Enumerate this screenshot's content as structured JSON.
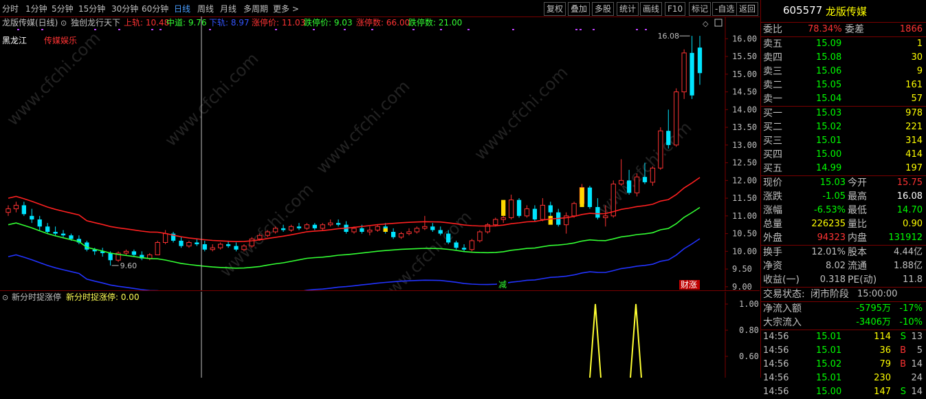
{
  "toolbar": {
    "periods": [
      "分时",
      "1分钟",
      "5分钟",
      "15分钟",
      "30分钟",
      "60分钟",
      "日线",
      "周线",
      "月线",
      "多周期",
      "更多 >"
    ],
    "active_period": "日线",
    "buttons": [
      "复权",
      "叠加",
      "多股",
      "统计",
      "画线",
      "F10",
      "标记",
      "-自选",
      "返回"
    ]
  },
  "main": {
    "title": "龙版传媒(日线)",
    "indicator_name": "独创龙行天下",
    "params": [
      {
        "label": "上轨: 10.48",
        "color": "#ff3333"
      },
      {
        "label": "中道: 9.76",
        "color": "#33ff33"
      },
      {
        "label": "下轨: 8.97",
        "color": "#3355ff"
      },
      {
        "label": "涨停价: 11.03",
        "color": "#ff3333"
      },
      {
        "label": "跌停价: 9.03",
        "color": "#33ff33"
      },
      {
        "label": "涨停数: 66.00",
        "color": "#ff3333"
      },
      {
        "label": "跌停数: 21.00",
        "color": "#33ff33"
      }
    ],
    "tag1": "黑龙江",
    "tag2": "传媒娱乐",
    "y_axis": [
      "16.00",
      "15.50",
      "15.00",
      "14.50",
      "14.00",
      "13.50",
      "13.00",
      "12.50",
      "12.00",
      "11.50",
      "11.00",
      "10.50",
      "10.00",
      "9.50",
      "9.00"
    ],
    "high_label": "16.08",
    "low_label": "9.60",
    "marker_reduce": "减",
    "marker_limit": "财涨"
  },
  "sub": {
    "title": "新分时捉涨停",
    "value_label": "新分时捉涨停: 0.00",
    "y_axis": [
      "1.00",
      "0.80",
      "0.60"
    ]
  },
  "watermark": "www.cfchi.com",
  "quote": {
    "code": "605577",
    "name": "龙版传媒",
    "weibi_label": "委比",
    "weibi": "78.34%",
    "weicha_label": "委差",
    "weicha": "1866",
    "asks": [
      {
        "label": "卖五",
        "price": "15.09",
        "vol": "1"
      },
      {
        "label": "卖四",
        "price": "15.08",
        "vol": "30"
      },
      {
        "label": "卖三",
        "price": "15.06",
        "vol": "9"
      },
      {
        "label": "卖二",
        "price": "15.05",
        "vol": "161"
      },
      {
        "label": "卖一",
        "price": "15.04",
        "vol": "57"
      }
    ],
    "bids": [
      {
        "label": "买一",
        "price": "15.03",
        "vol": "978"
      },
      {
        "label": "买二",
        "price": "15.02",
        "vol": "221"
      },
      {
        "label": "买三",
        "price": "15.01",
        "vol": "314"
      },
      {
        "label": "买四",
        "price": "15.00",
        "vol": "414"
      },
      {
        "label": "买五",
        "price": "14.99",
        "vol": "197"
      }
    ],
    "stats": [
      {
        "l1": "现价",
        "v1": "15.03",
        "c1": "#00ff00",
        "l2": "今开",
        "v2": "15.75",
        "c2": "#ff3333"
      },
      {
        "l1": "涨跌",
        "v1": "-1.05",
        "c1": "#00ff00",
        "l2": "最高",
        "v2": "16.08",
        "c2": "#ffffff"
      },
      {
        "l1": "涨幅",
        "v1": "-6.53%",
        "c1": "#00ff00",
        "l2": "最低",
        "v2": "14.70",
        "c2": "#00ff00"
      },
      {
        "l1": "总量",
        "v1": "226235",
        "c1": "#ffff00",
        "l2": "量比",
        "v2": "0.90",
        "c2": "#ffff00"
      },
      {
        "l1": "外盘",
        "v1": "94323",
        "c1": "#ff3333",
        "l2": "内盘",
        "v2": "131912",
        "c2": "#00ff00"
      }
    ],
    "stats2": [
      {
        "l1": "换手",
        "v1": "12.01%",
        "l2": "股本",
        "v2": "4.44亿"
      },
      {
        "l1": "净资",
        "v1": "8.02",
        "l2": "流通",
        "v2": "1.88亿"
      },
      {
        "l1": "收益(一)",
        "v1": "0.318",
        "l2": "PE(动)",
        "v2": "11.8"
      }
    ],
    "status_label": "交易状态:",
    "status": "闭市阶段",
    "status_time": "15:00:00",
    "flow": [
      {
        "label": "净流入额",
        "val": "-5795万",
        "pct": "-17%"
      },
      {
        "label": "大宗流入",
        "val": "-3406万",
        "pct": "-10%"
      }
    ],
    "ticks": [
      {
        "time": "14:56",
        "price": "15.01",
        "vol": "114",
        "side": "S",
        "n": "13"
      },
      {
        "time": "14:56",
        "price": "15.01",
        "vol": "36",
        "side": "B",
        "n": "5"
      },
      {
        "time": "14:56",
        "price": "15.02",
        "vol": "79",
        "side": "B",
        "n": "14"
      },
      {
        "time": "14:56",
        "price": "15.01",
        "vol": "230",
        "side": "",
        "n": "24"
      },
      {
        "time": "14:56",
        "price": "15.00",
        "vol": "147",
        "side": "S",
        "n": "14"
      }
    ]
  },
  "chart_data": {
    "type": "candlestick",
    "title": "龙版传媒(日线)",
    "ylim": [
      8.9,
      16.2
    ],
    "candles": [
      [
        11.1,
        11.3,
        11.0,
        11.2
      ],
      [
        11.2,
        11.4,
        11.1,
        11.3
      ],
      [
        11.3,
        11.4,
        11.0,
        11.05
      ],
      [
        11.0,
        11.2,
        10.8,
        10.9
      ],
      [
        10.9,
        11.0,
        10.6,
        10.7
      ],
      [
        10.7,
        10.8,
        10.5,
        10.55
      ],
      [
        10.55,
        10.7,
        10.45,
        10.5
      ],
      [
        10.5,
        10.6,
        10.4,
        10.45
      ],
      [
        10.45,
        10.5,
        10.3,
        10.35
      ],
      [
        10.35,
        10.45,
        10.2,
        10.25
      ],
      [
        10.25,
        10.3,
        10.0,
        10.05
      ],
      [
        10.05,
        10.1,
        9.9,
        10.0
      ],
      [
        10.0,
        10.1,
        9.85,
        9.95
      ],
      [
        9.95,
        10.0,
        9.6,
        9.75
      ],
      [
        9.75,
        10.0,
        9.7,
        9.95
      ],
      [
        9.95,
        10.05,
        9.9,
        10.0
      ],
      [
        10.0,
        10.05,
        9.85,
        9.9
      ],
      [
        9.9,
        10.0,
        9.75,
        9.8
      ],
      [
        9.8,
        9.95,
        9.75,
        9.9
      ],
      [
        9.9,
        10.3,
        9.9,
        10.25
      ],
      [
        10.25,
        10.6,
        10.2,
        10.5
      ],
      [
        10.5,
        10.55,
        10.25,
        10.3
      ],
      [
        10.3,
        10.4,
        10.1,
        10.15
      ],
      [
        10.15,
        10.3,
        10.1,
        10.25
      ],
      [
        10.25,
        10.35,
        10.15,
        10.2
      ],
      [
        10.2,
        10.3,
        10.0,
        10.05
      ],
      [
        10.05,
        10.2,
        10.0,
        10.1
      ],
      [
        10.1,
        10.25,
        10.05,
        10.2
      ],
      [
        10.2,
        10.3,
        10.1,
        10.15
      ],
      [
        10.15,
        10.25,
        10.0,
        10.05
      ],
      [
        10.05,
        10.2,
        10.0,
        10.15
      ],
      [
        10.15,
        10.4,
        10.1,
        10.35
      ],
      [
        10.35,
        10.5,
        10.3,
        10.45
      ],
      [
        10.45,
        10.6,
        10.4,
        10.55
      ],
      [
        10.55,
        10.7,
        10.5,
        10.65
      ],
      [
        10.65,
        10.75,
        10.55,
        10.6
      ],
      [
        10.6,
        10.75,
        10.55,
        10.7
      ],
      [
        10.7,
        10.8,
        10.6,
        10.65
      ],
      [
        10.65,
        10.8,
        10.6,
        10.75
      ],
      [
        10.75,
        10.8,
        10.6,
        10.65
      ],
      [
        10.65,
        10.8,
        10.6,
        10.75
      ],
      [
        10.75,
        10.9,
        10.7,
        10.8
      ],
      [
        10.8,
        10.9,
        10.7,
        10.75
      ],
      [
        10.75,
        10.85,
        10.5,
        10.55
      ],
      [
        10.55,
        10.7,
        10.5,
        10.65
      ],
      [
        10.65,
        10.75,
        10.5,
        10.55
      ],
      [
        10.55,
        10.7,
        10.45,
        10.6
      ],
      [
        10.6,
        10.75,
        10.55,
        10.7
      ],
      [
        10.7,
        10.8,
        10.5,
        10.55
      ],
      [
        10.55,
        10.65,
        10.35,
        10.4
      ],
      [
        10.4,
        10.55,
        10.35,
        10.5
      ],
      [
        10.5,
        10.65,
        10.45,
        10.55
      ],
      [
        10.55,
        10.7,
        10.5,
        10.65
      ],
      [
        10.65,
        11.0,
        10.6,
        10.7
      ],
      [
        10.7,
        10.8,
        10.55,
        10.6
      ],
      [
        10.6,
        10.7,
        10.45,
        10.5
      ],
      [
        10.5,
        10.6,
        10.2,
        10.25
      ],
      [
        10.25,
        10.3,
        10.05,
        10.1
      ],
      [
        10.1,
        10.2,
        10.0,
        10.05
      ],
      [
        10.05,
        10.35,
        10.0,
        10.3
      ],
      [
        10.3,
        10.6,
        10.25,
        10.55
      ],
      [
        10.55,
        10.8,
        10.5,
        10.75
      ],
      [
        10.75,
        10.95,
        10.7,
        10.9
      ],
      [
        10.9,
        11.0,
        10.8,
        10.95
      ],
      [
        10.95,
        11.6,
        10.9,
        11.45
      ],
      [
        11.45,
        11.5,
        10.95,
        11.0
      ],
      [
        11.0,
        11.3,
        10.95,
        11.2
      ],
      [
        11.2,
        11.3,
        10.85,
        10.9
      ],
      [
        10.9,
        11.5,
        10.85,
        11.3
      ],
      [
        11.3,
        11.4,
        11.0,
        11.1
      ],
      [
        11.1,
        11.2,
        10.7,
        10.75
      ],
      [
        10.75,
        11.1,
        10.5,
        11.0
      ],
      [
        11.0,
        11.4,
        10.95,
        11.35
      ],
      [
        11.35,
        11.9,
        11.3,
        11.8
      ],
      [
        11.8,
        11.85,
        11.2,
        11.25
      ],
      [
        11.25,
        11.5,
        10.9,
        10.95
      ],
      [
        10.95,
        11.3,
        10.7,
        11.0
      ],
      [
        11.0,
        12.0,
        10.95,
        11.9
      ],
      [
        11.9,
        12.6,
        11.85,
        12.0
      ],
      [
        12.0,
        12.3,
        11.6,
        11.65
      ],
      [
        11.65,
        12.2,
        11.55,
        12.1
      ],
      [
        12.1,
        12.5,
        11.9,
        11.95
      ],
      [
        11.95,
        12.4,
        11.85,
        12.35
      ],
      [
        12.35,
        13.5,
        12.3,
        13.4
      ],
      [
        13.4,
        14.0,
        12.9,
        13.0
      ],
      [
        13.0,
        14.6,
        12.95,
        14.5
      ],
      [
        14.5,
        15.7,
        14.3,
        15.6
      ],
      [
        15.6,
        16.08,
        14.3,
        14.4
      ],
      [
        15.75,
        16.08,
        14.7,
        15.03
      ]
    ],
    "upper_band_last": 12.05,
    "middle_band_last": 11.2,
    "lower_band_last": 10.32
  }
}
